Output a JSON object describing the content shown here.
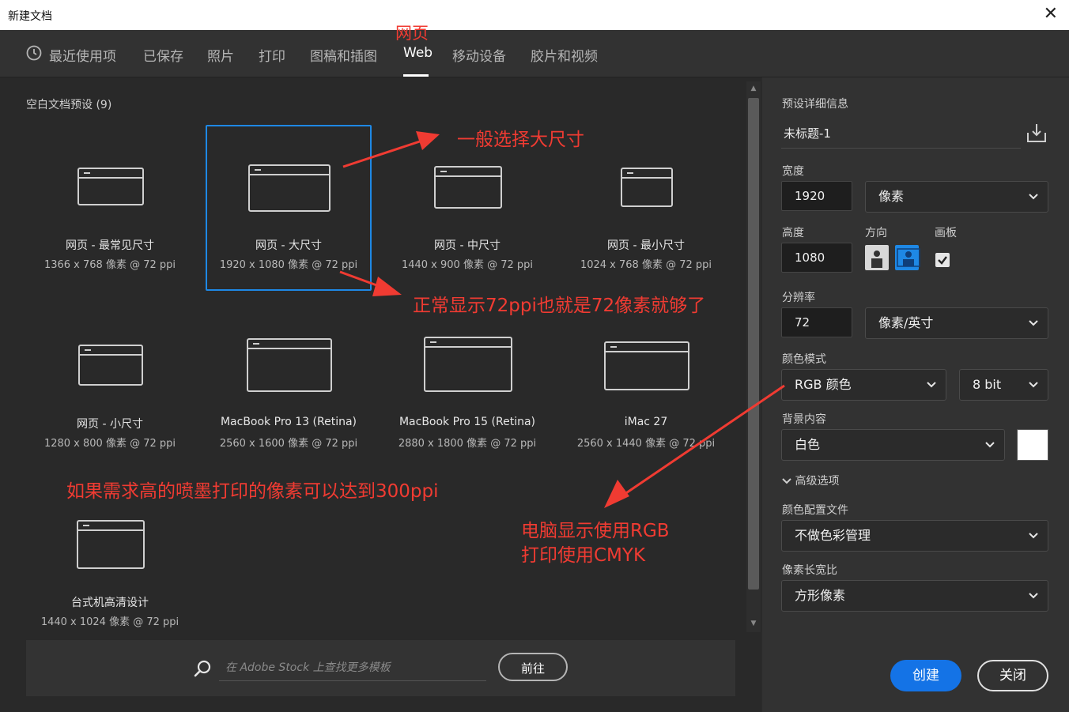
{
  "window": {
    "title": "新建文档",
    "close_glyph": "✕"
  },
  "tabs": [
    {
      "label": "最近使用项",
      "active": false
    },
    {
      "label": "已保存",
      "active": false
    },
    {
      "label": "照片",
      "active": false
    },
    {
      "label": "打印",
      "active": false
    },
    {
      "label": "图稿和插图",
      "active": false
    },
    {
      "label": "Web",
      "active": true
    },
    {
      "label": "移动设备",
      "active": false
    },
    {
      "label": "胶片和视频",
      "active": false
    }
  ],
  "presets": {
    "section_title": "空白文档预设 (9)",
    "items": [
      {
        "name": "网页 - 最常见尺寸",
        "spec": "1366 x 768 像素 @ 72 ppi",
        "selected": false
      },
      {
        "name": "网页 - 大尺寸",
        "spec": "1920 x 1080 像素 @ 72 ppi",
        "selected": true
      },
      {
        "name": "网页 - 中尺寸",
        "spec": "1440 x 900 像素 @ 72 ppi",
        "selected": false
      },
      {
        "name": "网页 - 最小尺寸",
        "spec": "1024 x 768 像素 @ 72 ppi",
        "selected": false
      },
      {
        "name": "网页 - 小尺寸",
        "spec": "1280 x 800 像素 @ 72 ppi",
        "selected": false
      },
      {
        "name": "MacBook Pro 13 (Retina)",
        "spec": "2560 x 1600 像素 @ 72 ppi",
        "selected": false
      },
      {
        "name": "MacBook Pro 15 (Retina)",
        "spec": "2880 x 1800 像素 @ 72 ppi",
        "selected": false
      },
      {
        "name": "iMac 27",
        "spec": "2560 x 1440 像素 @ 72 ppi",
        "selected": false
      },
      {
        "name": "台式机高清设计",
        "spec": "1440 x 1024 像素 @ 72 ppi",
        "selected": false
      }
    ]
  },
  "stock": {
    "placeholder": "在 Adobe Stock 上查找更多模板",
    "go_label": "前往"
  },
  "details": {
    "header": "预设详细信息",
    "doc_name": "未标题-1",
    "width_label": "宽度",
    "width_value": "1920",
    "width_unit": "像素",
    "height_label": "高度",
    "height_value": "1080",
    "orientation_label": "方向",
    "artboard_label": "画板",
    "artboard_checked": true,
    "resolution_label": "分辨率",
    "resolution_value": "72",
    "resolution_unit": "像素/英寸",
    "color_mode_label": "颜色模式",
    "color_mode": "RGB 颜色",
    "bit_depth": "8 bit",
    "background_label": "背景内容",
    "background_value": "白色",
    "background_color": "#ffffff",
    "advanced_label": "高级选项",
    "color_profile_label": "颜色配置文件",
    "color_profile": "不做色彩管理",
    "pixel_aspect_label": "像素长宽比",
    "pixel_aspect": "方形像素"
  },
  "buttons": {
    "create": "创建",
    "close": "关闭"
  },
  "annotations": {
    "web_tab_note": "网页",
    "size_note": "一般选择大尺寸",
    "ppi_note": "正常显示72ppi也就是72像素就够了",
    "print_note": "如果需求高的喷墨打印的像素可以达到300ppi",
    "color_note_line1": "电脑显示使用RGB",
    "color_note_line2": "打印使用CMYK",
    "color": "#f03b32"
  },
  "colors": {
    "accent": "#1e88e5",
    "button_primary": "#1473e6"
  }
}
